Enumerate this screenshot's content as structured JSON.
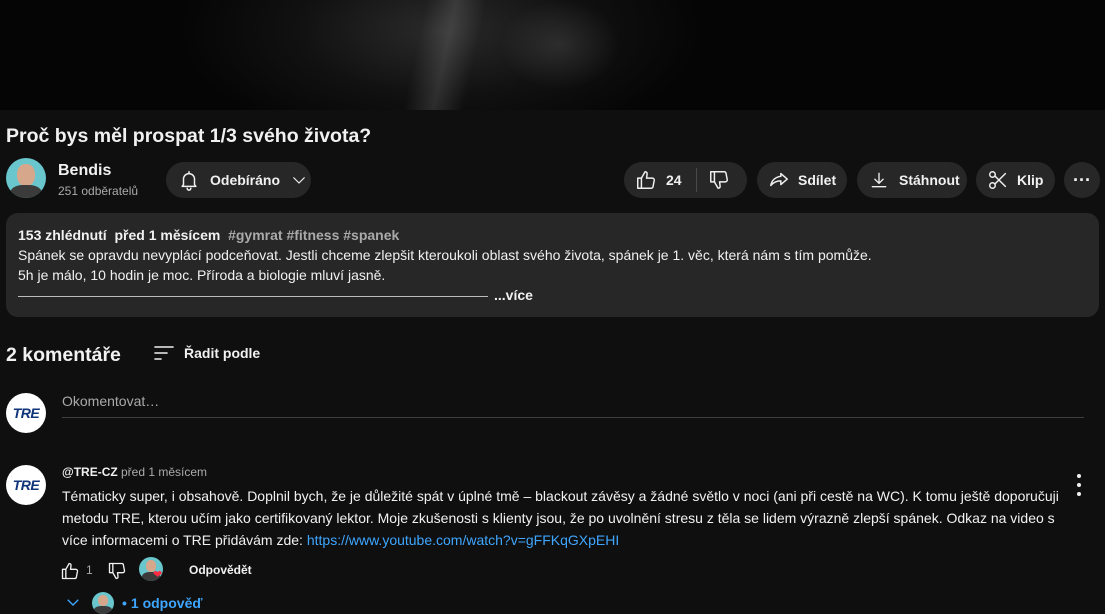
{
  "video": {
    "title": "Proč bys měl prospat 1/3 svého života?"
  },
  "channel": {
    "name": "Bendis",
    "subscribers": "251 odběratelů"
  },
  "actions": {
    "subscribe_label": "Odebíráno",
    "like_count": "24",
    "share_label": "Sdílet",
    "download_label": "Stáhnout",
    "clip_label": "Klip",
    "more_label": "···"
  },
  "description": {
    "views": "153 zhlédnutí",
    "age": "před 1 měsícem",
    "tags": "#gymrat #fitness #spanek",
    "line1": "Spánek se opravdu nevyplácí podceňovat. Jestli chceme zlepšit kteroukoli oblast svého života, spánek je 1. věc, která nám s tím pomůže.",
    "line2": "5h je málo, 10 hodin je moc. Příroda a biologie mluví jasně.",
    "more_label": "...více"
  },
  "comments": {
    "count_label": "2 komentáře",
    "sort_label": "Řadit podle",
    "input_placeholder": "Okomentovat…",
    "user_avatar_text": "TRE",
    "items": [
      {
        "avatar_text": "TRE",
        "author": "@TRE-CZ",
        "time": "před 1 měsícem",
        "text": "Tématicky super, i obsahově. Doplnil bych, že je důležité spát v úplné tmě – blackout závěsy a žádné světlo v noci (ani při cestě na WC). K tomu ještě doporučuji metodu TRE, kterou učím jako certifikovaný lektor. Moje zkušenosti s klienty jsou, že po uvolnění stresu z těla se lidem výrazně zlepší spánek. Odkaz na video s více informacemi o TRE přidávám zde: ",
        "link": "https://www.youtube.com/watch?v=gFFKqGXpEHI",
        "likes": "1",
        "reply_label": "Odpovědět",
        "heart": "❤",
        "replies_bullet": "•",
        "replies_label": "1 odpověď"
      }
    ]
  }
}
